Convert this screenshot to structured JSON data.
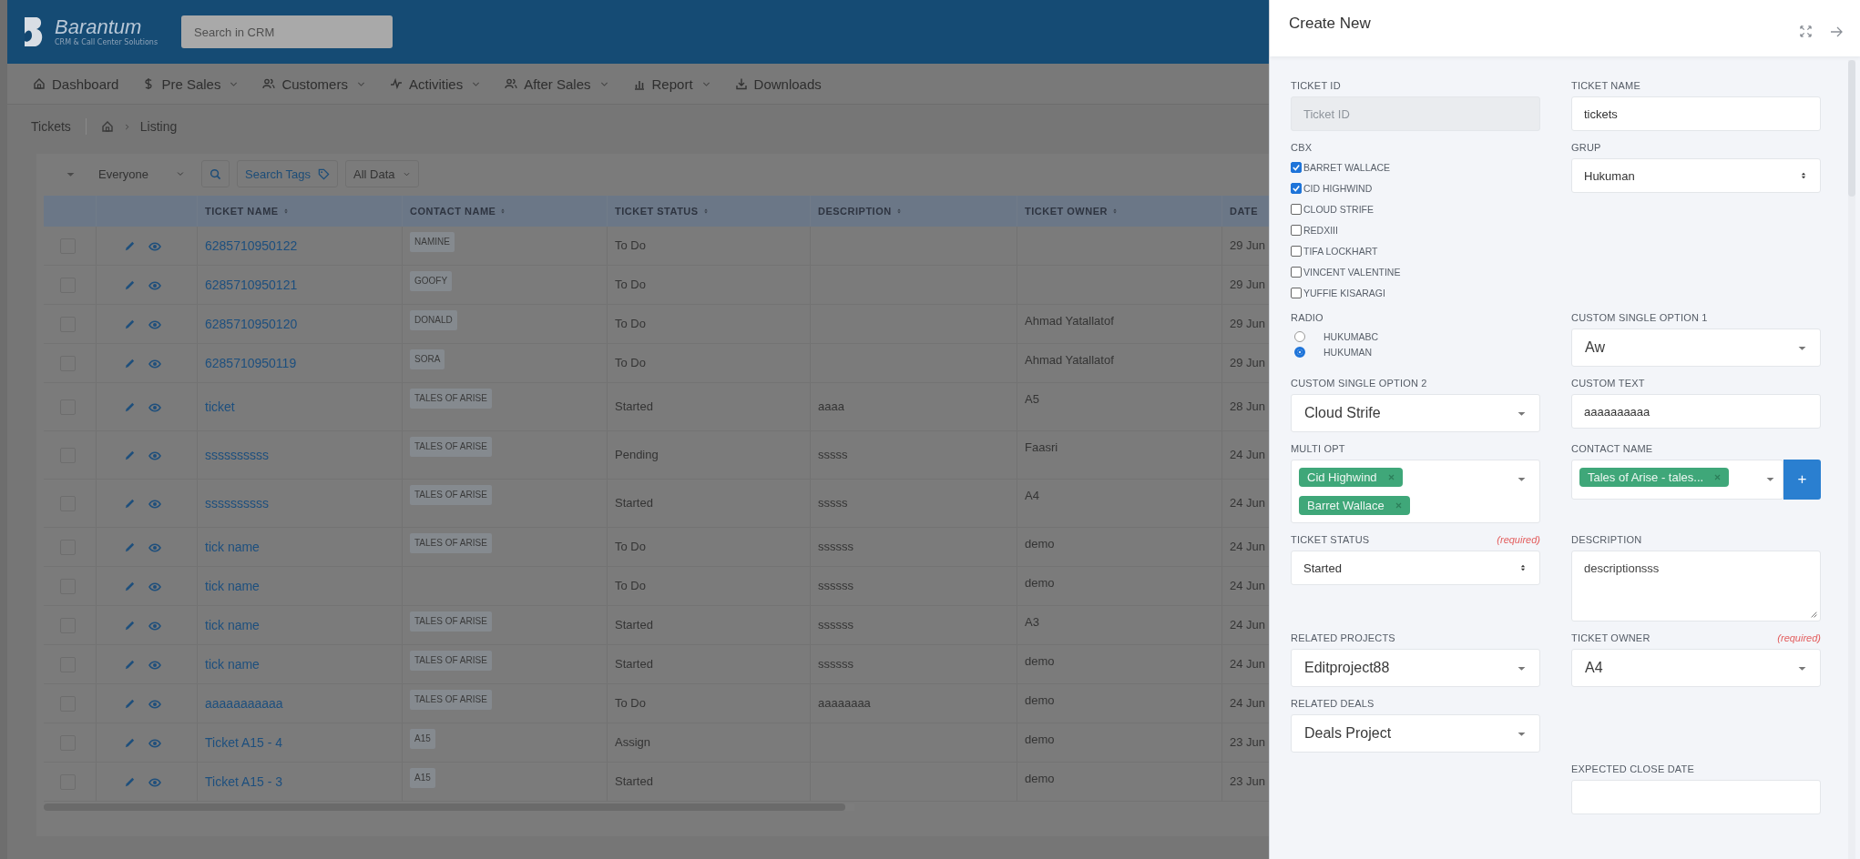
{
  "header": {
    "logo_name": "Barantum",
    "logo_tagline": "CRM & Call Center Solutions",
    "search": {
      "placeholder": "Search in CRM"
    }
  },
  "nav": [
    {
      "kind": "home",
      "label": "Dashboard",
      "dropdown": false
    },
    {
      "kind": "dollar",
      "label": "Pre Sales",
      "dropdown": true
    },
    {
      "kind": "users",
      "label": "Customers",
      "dropdown": true
    },
    {
      "kind": "pulse",
      "label": "Activities",
      "dropdown": true
    },
    {
      "kind": "users",
      "label": "After Sales",
      "dropdown": true
    },
    {
      "kind": "chart",
      "label": "Report",
      "dropdown": true
    },
    {
      "kind": "download",
      "label": "Downloads",
      "dropdown": false
    }
  ],
  "breadcrumb": {
    "title": "Tickets",
    "current": "Listing"
  },
  "toolbar": {
    "owner_filter": "Everyone",
    "search_tags": "Search Tags",
    "scope": "All Data"
  },
  "table": {
    "columns": [
      "TICKET NAME",
      "CONTACT NAME",
      "TICKET STATUS",
      "DESCRIPTION",
      "TICKET OWNER",
      "DATE"
    ],
    "rows": [
      {
        "checked": false,
        "ticket_name": "6285710950122",
        "contact": "NAMINE",
        "status": "To Do",
        "description": "",
        "owner": "",
        "date": "29 Jun"
      },
      {
        "checked": false,
        "ticket_name": "6285710950121",
        "contact": "GOOFY",
        "status": "To Do",
        "description": "",
        "owner": "",
        "date": "29 Jun"
      },
      {
        "checked": false,
        "ticket_name": "6285710950120",
        "contact": "DONALD",
        "status": "To Do",
        "description": "",
        "owner": "Ahmad Yatallatof",
        "date": "29 Jun"
      },
      {
        "checked": false,
        "ticket_name": "6285710950119",
        "contact": "SORA",
        "status": "To Do",
        "description": "",
        "owner": "Ahmad Yatallatof",
        "date": "29 Jun"
      },
      {
        "checked": false,
        "ticket_name": "ticket",
        "contact": "TALES OF ARISE",
        "status": "Started",
        "description": "aaaa",
        "owner": "A5",
        "date": "28 Jun"
      },
      {
        "checked": false,
        "ticket_name": "ssssssssss",
        "contact": "TALES OF ARISE",
        "status": "Pending",
        "description": "sssss",
        "owner": "Faasri",
        "date": "24 Jun"
      },
      {
        "checked": false,
        "ticket_name": "ssssssssss",
        "contact": "TALES OF ARISE",
        "status": "Started",
        "description": "sssss",
        "owner": "A4",
        "date": "24 Jun"
      },
      {
        "checked": false,
        "ticket_name": "tick name",
        "contact": "TALES OF ARISE",
        "status": "To Do",
        "description": "ssssss",
        "owner": "demo",
        "date": "24 Jun"
      },
      {
        "checked": false,
        "ticket_name": "tick name",
        "contact": "",
        "status": "To Do",
        "description": "ssssss",
        "owner": "demo",
        "date": "24 Jun"
      },
      {
        "checked": false,
        "ticket_name": "tick name",
        "contact": "TALES OF ARISE",
        "status": "Started",
        "description": "ssssss",
        "owner": "A3",
        "date": "24 Jun"
      },
      {
        "checked": false,
        "ticket_name": "tick name",
        "contact": "TALES OF ARISE",
        "status": "Started",
        "description": "ssssss",
        "owner": "demo",
        "date": "24 Jun"
      },
      {
        "checked": false,
        "ticket_name": "aaaaaaaaaaa",
        "contact": "TALES OF ARISE",
        "status": "To Do",
        "description": "aaaaaaaa",
        "owner": "demo",
        "date": "24 Jun"
      },
      {
        "checked": false,
        "ticket_name": "Ticket A15 - 4",
        "contact": "A15",
        "status": "Assign",
        "description": "",
        "owner": "demo",
        "date": "23 Jun"
      },
      {
        "checked": false,
        "ticket_name": "Ticket A15 - 3",
        "contact": "A15",
        "status": "Started",
        "description": "",
        "owner": "demo",
        "date": "23 Jun"
      }
    ]
  },
  "panel": {
    "title": "Create New",
    "rows": [
      [
        {
          "kind": "input",
          "label": "TICKET ID",
          "placeholder": "Ticket ID",
          "disabled": true
        },
        {
          "kind": "input",
          "label": "TICKET NAME",
          "value": "tickets",
          "disabled": false
        }
      ],
      [
        {
          "kind": "checkboxes",
          "label": "CBX",
          "options": [
            {
              "label": "BARRET WALLACE",
              "checked": true
            },
            {
              "label": "CID HIGHWIND",
              "checked": true
            },
            {
              "label": "CLOUD STRIFE",
              "checked": false
            },
            {
              "label": "REDXIII",
              "checked": false
            },
            {
              "label": "TIFA LOCKHART",
              "checked": false
            },
            {
              "label": "VINCENT VALENTINE",
              "checked": false
            },
            {
              "label": "YUFFIE KISARAGI",
              "checked": false
            }
          ]
        },
        {
          "kind": "select",
          "label": "GRUP",
          "value": "Hukuman"
        }
      ],
      [
        {
          "kind": "radios",
          "label": "RADIO",
          "options": [
            {
              "label": "HUKUMABC",
              "selected": false
            },
            {
              "label": "HUKUMAN",
              "selected": true
            }
          ]
        },
        {
          "kind": "dropdown",
          "label": "CUSTOM SINGLE OPTION 1",
          "value": "Aw"
        }
      ],
      [
        {
          "kind": "dropdown",
          "label": "CUSTOM SINGLE OPTION 2",
          "value": "Cloud Strife"
        },
        {
          "kind": "input",
          "label": "CUSTOM TEXT",
          "value": "aaaaaaaaaa",
          "disabled": false
        }
      ],
      [
        {
          "kind": "multi",
          "label": "MULTI OPT",
          "tags": [
            "Cid Highwind",
            "Barret Wallace"
          ]
        },
        {
          "kind": "contact",
          "label": "CONTACT NAME",
          "tags": [
            "Tales of Arise - tales..."
          ],
          "add": "+"
        }
      ],
      [
        {
          "kind": "select",
          "label": "TICKET STATUS",
          "required": "(required)",
          "value": "Started"
        },
        {
          "kind": "textarea",
          "label": "DESCRIPTION",
          "value": "descriptionsss"
        }
      ],
      [
        {
          "kind": "dropdown",
          "label": "RELATED PROJECTS",
          "value": "Editproject88"
        },
        {
          "kind": "dropdown",
          "label": "TICKET OWNER",
          "required": "(required)",
          "value": "A4"
        }
      ],
      [
        {
          "kind": "dropdown",
          "label": "RELATED DEALS",
          "value": "Deals Project"
        },
        null
      ],
      [
        null,
        {
          "kind": "input",
          "label": "EXPECTED CLOSE DATE",
          "disabled": false
        }
      ]
    ]
  }
}
